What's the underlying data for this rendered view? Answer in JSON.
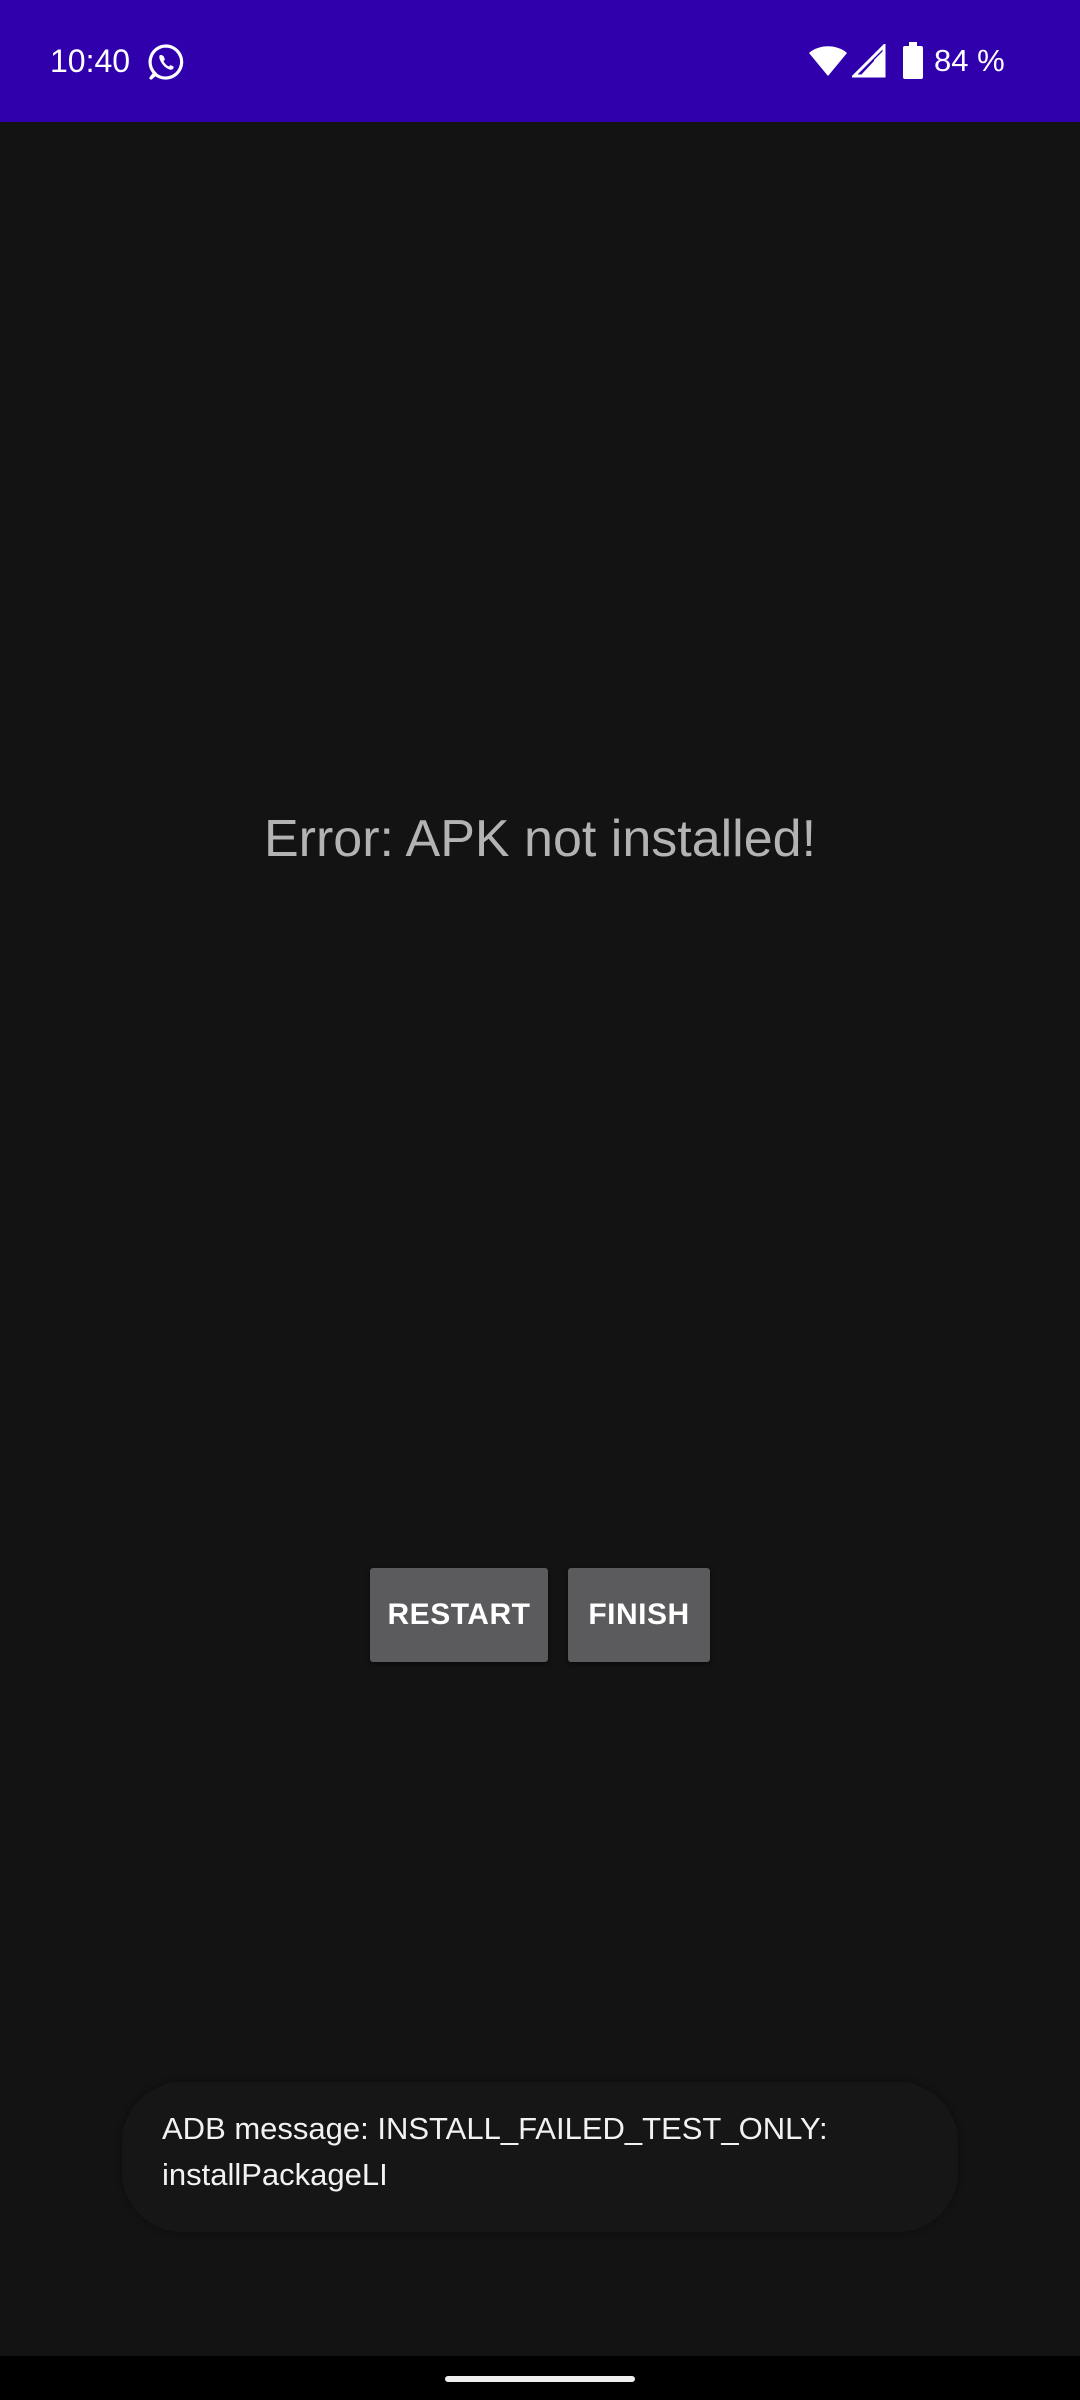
{
  "status_bar": {
    "time": "10:40",
    "battery": "84 %",
    "background_color": "#3000ac",
    "icons": [
      "whatsapp-icon",
      "wifi-icon",
      "signal-icon",
      "battery-icon"
    ]
  },
  "main": {
    "error_title": "Error: APK not installed!",
    "buttons": {
      "restart_label": "RESTART",
      "finish_label": "FINISH"
    }
  },
  "toast": {
    "message": "ADB message: INSTALL_FAILED_TEST_ONLY:\ninstallPackageLI"
  },
  "colors": {
    "background": "#131313",
    "button": "#5b5b5e",
    "error_text": "#b3b3b3"
  }
}
